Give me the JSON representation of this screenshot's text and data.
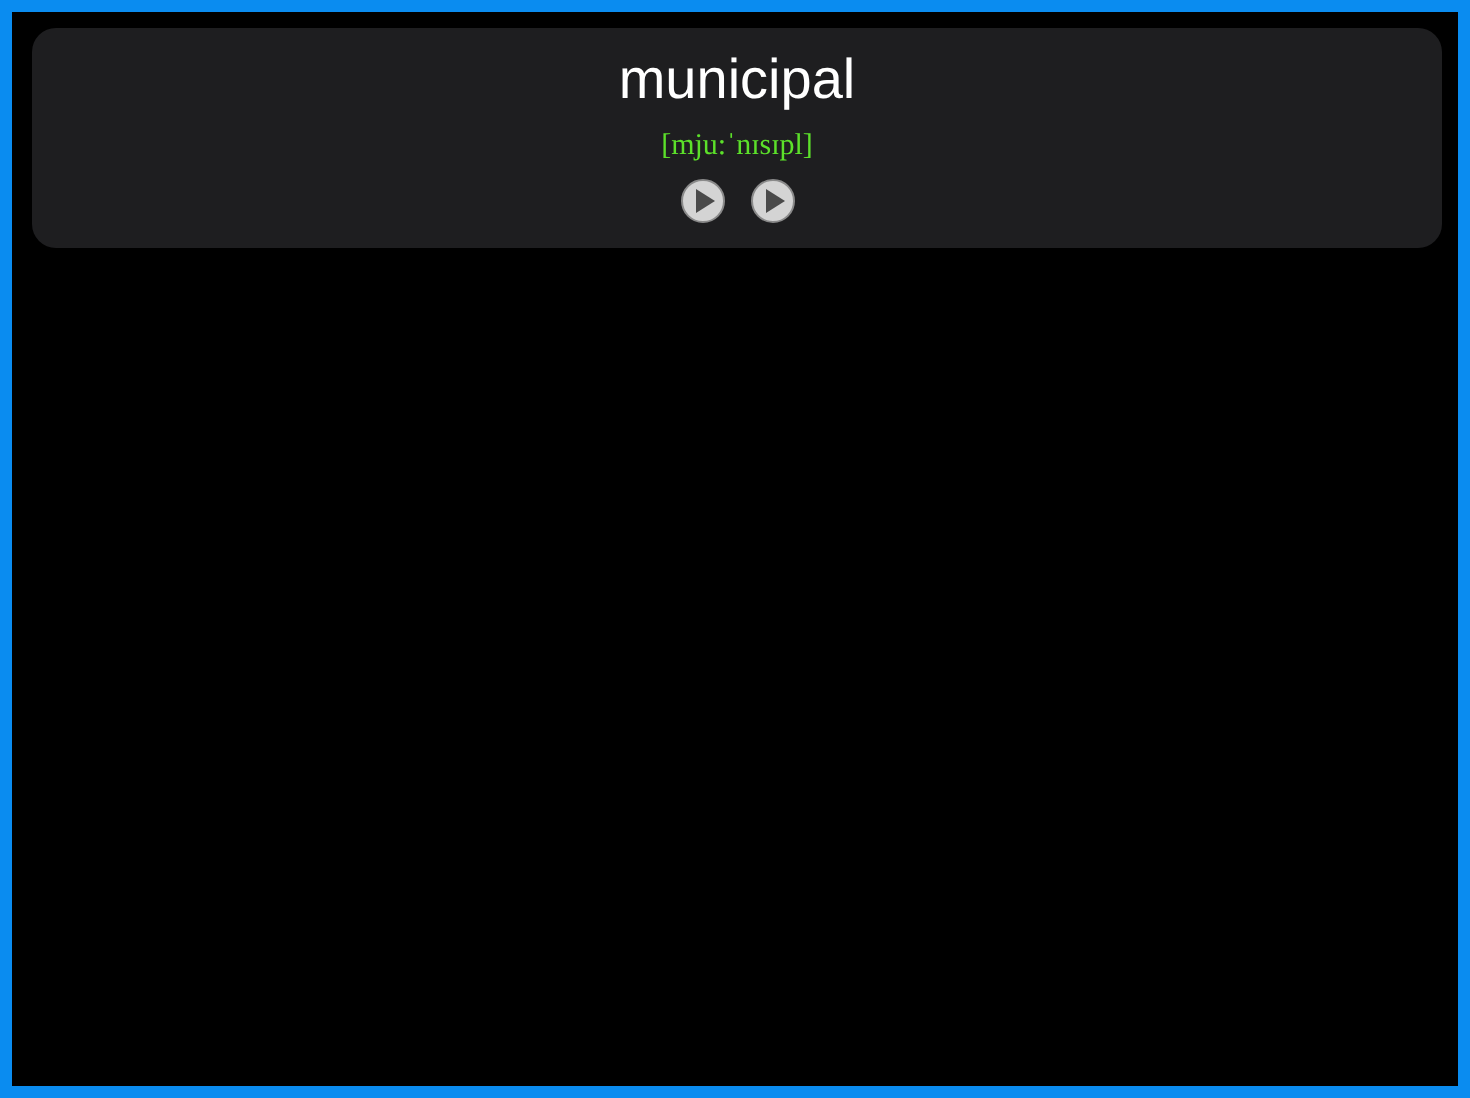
{
  "word": "municipal",
  "phonetic": "[mju:ˈnɪsɪpl]",
  "audio_buttons": [
    {
      "kind": "play"
    },
    {
      "kind": "play"
    }
  ]
}
